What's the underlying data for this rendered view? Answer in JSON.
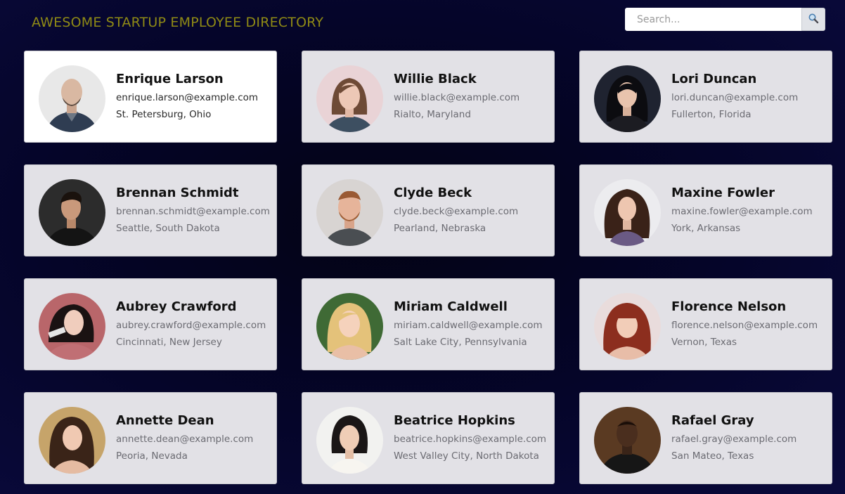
{
  "header": {
    "title": "AWESOME STARTUP EMPLOYEE DIRECTORY",
    "search_placeholder": "Search...",
    "search_value": "",
    "search_icon": "search-icon"
  },
  "employees": [
    {
      "name": "Enrique Larson",
      "email": "enrique.larson@example.com",
      "location": "St. Petersburg, Ohio"
    },
    {
      "name": "Willie Black",
      "email": "willie.black@example.com",
      "location": "Rialto, Maryland"
    },
    {
      "name": "Lori Duncan",
      "email": "lori.duncan@example.com",
      "location": "Fullerton, Florida"
    },
    {
      "name": "Brennan Schmidt",
      "email": "brennan.schmidt@example.com",
      "location": "Seattle, South Dakota"
    },
    {
      "name": "Clyde Beck",
      "email": "clyde.beck@example.com",
      "location": "Pearland, Nebraska"
    },
    {
      "name": "Maxine Fowler",
      "email": "maxine.fowler@example.com",
      "location": "York, Arkansas"
    },
    {
      "name": "Aubrey Crawford",
      "email": "aubrey.crawford@example.com",
      "location": "Cincinnati, New Jersey"
    },
    {
      "name": "Miriam Caldwell",
      "email": "miriam.caldwell@example.com",
      "location": "Salt Lake City, Pennsylvania"
    },
    {
      "name": "Florence Nelson",
      "email": "florence.nelson@example.com",
      "location": "Vernon, Texas"
    },
    {
      "name": "Annette Dean",
      "email": "annette.dean@example.com",
      "location": "Peoria, Nevada"
    },
    {
      "name": "Beatrice Hopkins",
      "email": "beatrice.hopkins@example.com",
      "location": "West Valley City, North Dakota"
    },
    {
      "name": "Rafael Gray",
      "email": "rafael.gray@example.com",
      "location": "San Mateo, Texas"
    }
  ],
  "colors": {
    "title": "#8f8a15",
    "card_bg": "#e2e1e6",
    "card_active_bg": "#ffffff",
    "page_bg": "#05052a"
  }
}
